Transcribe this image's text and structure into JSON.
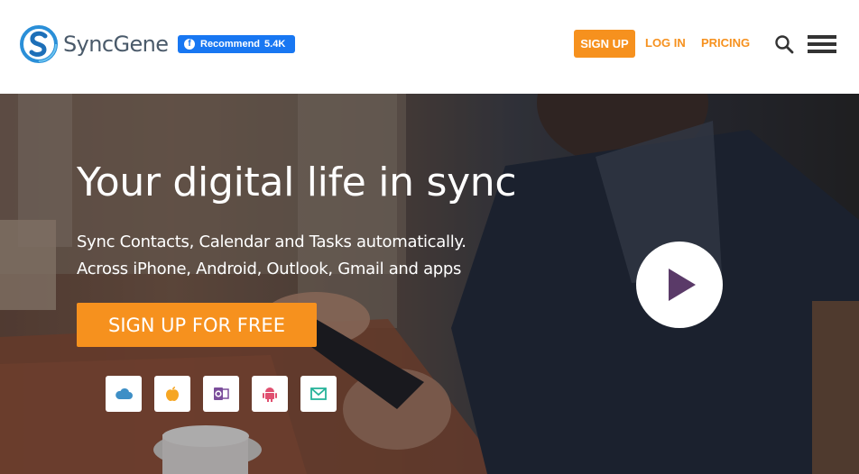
{
  "header": {
    "logo_text": "SyncGene",
    "facebook": {
      "label": "Recommend",
      "count": "5.4K"
    },
    "nav": {
      "signup": "SIGN UP",
      "login": "LOG IN",
      "pricing": "PRICING"
    }
  },
  "hero": {
    "title": "Your digital life in sync",
    "subtitle_line1": "Sync Contacts, Calendar and Tasks automatically.",
    "subtitle_line2": "Across iPhone, Android, Outlook, Gmail and apps",
    "cta": "SIGN UP FOR FREE",
    "app_icons": [
      "icloud-icon",
      "apple-icon",
      "outlook-icon",
      "android-icon",
      "gmail-icon"
    ]
  },
  "colors": {
    "accent": "#f6911e",
    "facebook": "#1877f2",
    "play_triangle": "#5a3a68"
  }
}
